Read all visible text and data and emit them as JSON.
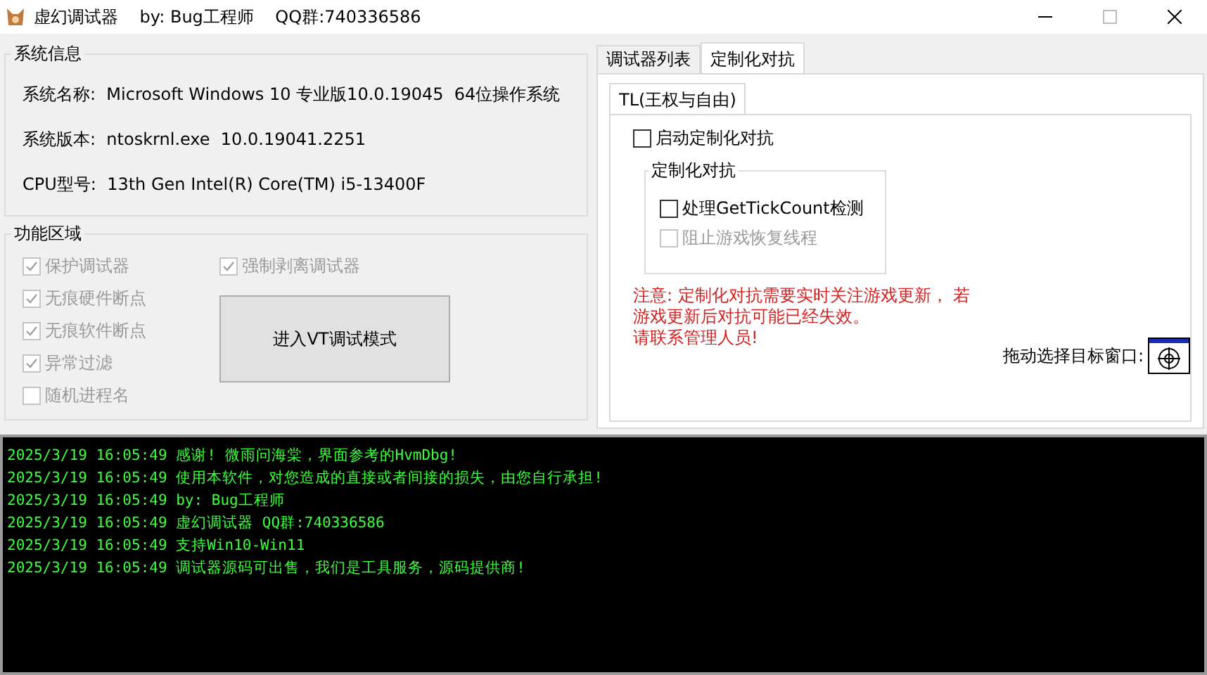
{
  "window": {
    "title": "虚幻调试器    by: Bug工程师    QQ群:740336586"
  },
  "system_info": {
    "title": "系统信息",
    "rows": [
      {
        "label": "系统名称:",
        "value": "Microsoft Windows 10 专业版10.0.19045  64位操作系统"
      },
      {
        "label": "系统版本:",
        "value": "ntoskrnl.exe  10.0.19041.2251"
      },
      {
        "label": "CPU型号:",
        "value": "13th Gen Intel(R) Core(TM) i5-13400F"
      }
    ]
  },
  "functions": {
    "title": "功能区域",
    "left_checks": [
      {
        "label": "保护调试器",
        "checked": true,
        "disabled": true
      },
      {
        "label": "无痕硬件断点",
        "checked": true,
        "disabled": true
      },
      {
        "label": "无痕软件断点",
        "checked": true,
        "disabled": true
      },
      {
        "label": "异常过滤",
        "checked": true,
        "disabled": true
      },
      {
        "label": "随机进程名",
        "checked": false,
        "disabled": true
      }
    ],
    "right_check": {
      "label": "强制剥离调试器",
      "checked": true,
      "disabled": true
    },
    "button": "进入VT调试模式"
  },
  "tabs": [
    {
      "label": "调试器列表",
      "selected": false
    },
    {
      "label": "定制化对抗",
      "selected": true
    }
  ],
  "inner_tabs": [
    {
      "label": "TL(王权与自由)",
      "selected": true
    }
  ],
  "enable_check": {
    "label": "启动定制化对抗",
    "checked": false,
    "disabled": false
  },
  "group": {
    "title": "定制化对抗",
    "checks": [
      {
        "label": "处理GetTickCount检测",
        "checked": false,
        "disabled": false
      },
      {
        "label": "阻止游戏恢复线程",
        "checked": false,
        "disabled": true
      }
    ]
  },
  "notice": [
    "注意: 定制化对抗需要实时关注游戏更新， 若",
    "游戏更新后对抗可能已经失效。",
    "请联系管理人员!"
  ],
  "target_label": "拖动选择目标窗口:",
  "log": [
    {
      "time": "2025/3/19 16:05:49",
      "text": "感谢! 微雨问海棠，界面参考的HvmDbg!"
    },
    {
      "time": "2025/3/19 16:05:49",
      "text": "使用本软件，对您造成的直接或者间接的损失，由您自行承担!"
    },
    {
      "time": "2025/3/19 16:05:49",
      "text": "by: Bug工程师"
    },
    {
      "time": "2025/3/19 16:05:49",
      "text": "虚幻调试器 QQ群:740336586"
    },
    {
      "time": "2025/3/19 16:05:49",
      "text": "支持Win10-Win11"
    },
    {
      "time": "2025/3/19 16:05:49",
      "text": "调试器源码可出售，我们是工具服务，源码提供商!"
    }
  ]
}
